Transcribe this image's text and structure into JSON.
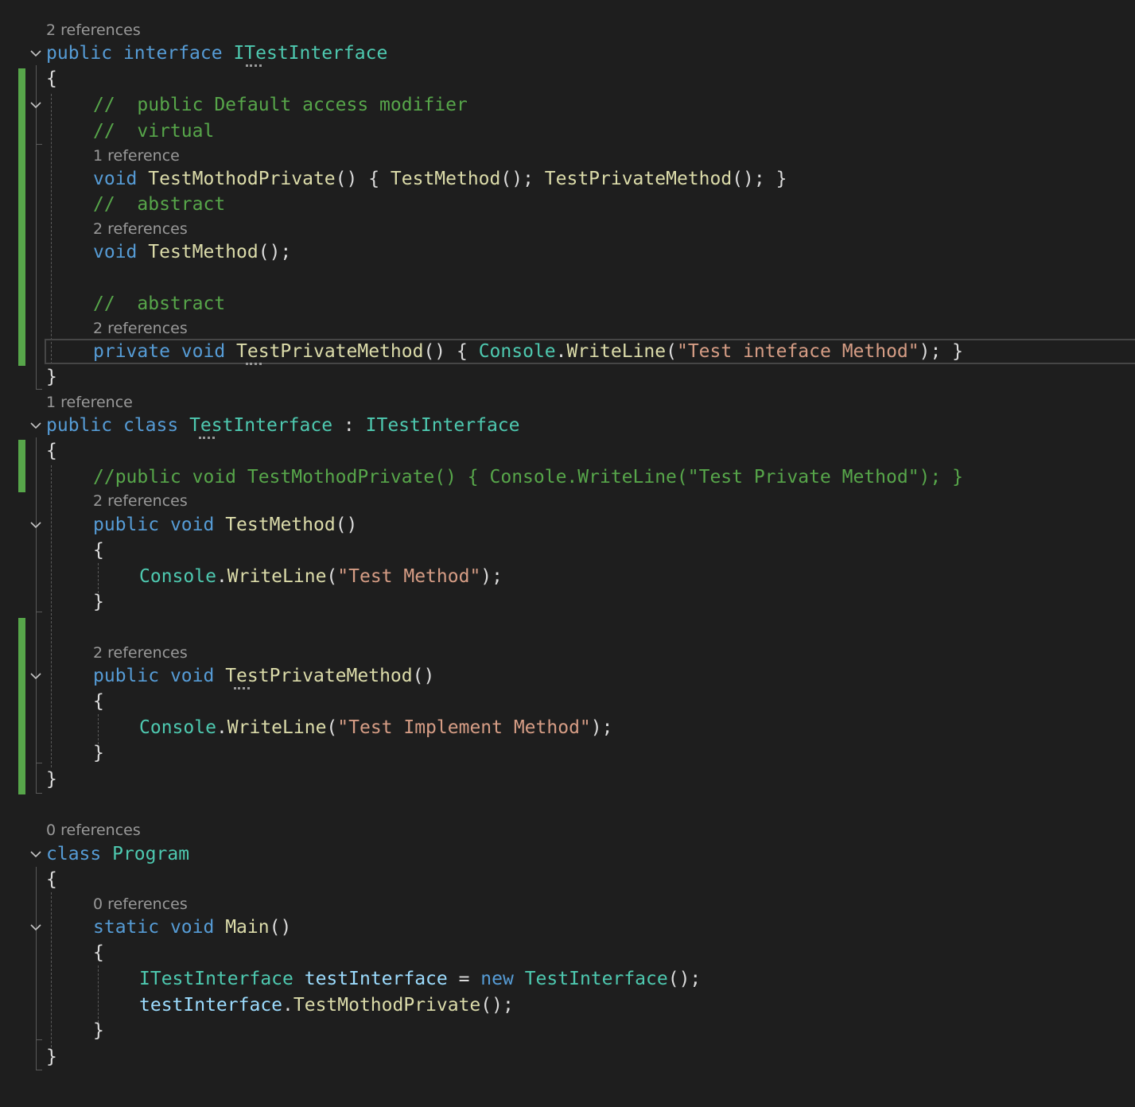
{
  "code_lens": {
    "l1": "2 references",
    "l2": "1 reference",
    "l3": "2 references",
    "l4": "2 references",
    "l5": "1 reference",
    "l6": "2 references",
    "l7": "2 references",
    "l8": "0 references",
    "l9": "0 references"
  },
  "code": {
    "interface_decl": {
      "kw1": "public",
      "kw2": "interface",
      "name": "ITestInterface"
    },
    "brace_open": "{",
    "brace_close": "}",
    "comment_public_default": "//  public Default access modifier",
    "comment_virtual": "//  virtual",
    "void_kw": "void",
    "public_kw": "public",
    "private_kw": "private",
    "static_kw": "static",
    "class_kw": "class",
    "new_kw": "new",
    "method_test_mothod_private": "TestMothodPrivate",
    "method_test_method": "TestMethod",
    "method_test_private_method": "TestPrivateMethod",
    "method_write_line": "WriteLine",
    "method_main": "Main",
    "type_console": "Console",
    "type_itestinterface": "ITestInterface",
    "type_testinterface": "TestInterface",
    "type_program": "Program",
    "var_test_interface": "testInterface",
    "comment_abstract": "//  abstract",
    "comment_impl_line": "//public void TestMothodPrivate() { Console.WriteLine(\"Test Private Method\"); }",
    "str_interface_method": "\"Test inteface Method\"",
    "str_test_method": "\"Test Method\"",
    "str_implement_method": "\"Test Implement Method\"",
    "p_parens": "()",
    "p_parens_space_brace": "() { ",
    "p_call_end": "(); ",
    "p_close_brace": "}",
    "p_semicolon_end": "();",
    "p_open_paren": "(",
    "p_close_stmt": ");",
    "p_close_stmt_brace": "); }",
    "p_dot": ".",
    "p_colon": " : ",
    "p_assign": " = "
  },
  "icons": {
    "fold": "chevron-down-icon"
  },
  "colors": {
    "background": "#1e1e1e",
    "keyword": "#569cd6",
    "type": "#4ec9b0",
    "method": "#dcdcaa",
    "string": "#d69d85",
    "comment": "#57a64a",
    "variable": "#9cdcfe",
    "change_bar": "#57a64a"
  }
}
